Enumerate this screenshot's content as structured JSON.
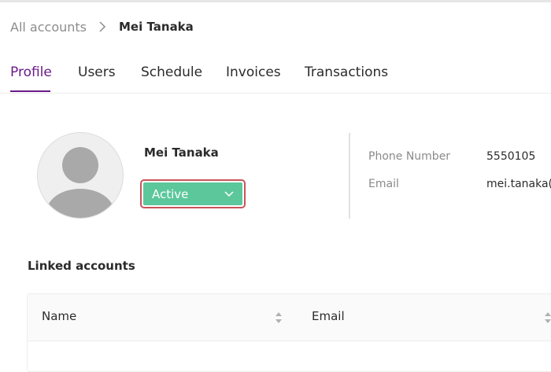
{
  "breadcrumb": {
    "root": "All accounts",
    "current": "Mei Tanaka"
  },
  "tabs": [
    {
      "label": "Profile",
      "active": true
    },
    {
      "label": "Users",
      "active": false
    },
    {
      "label": "Schedule",
      "active": false
    },
    {
      "label": "Invoices",
      "active": false
    },
    {
      "label": "Transactions",
      "active": false
    }
  ],
  "profile": {
    "name": "Mei Tanaka",
    "status": "Active"
  },
  "contact": {
    "phone_label": "Phone Number",
    "phone_value": "5550105",
    "email_label": "Email",
    "email_value": "mei.tanaka("
  },
  "linked_accounts": {
    "title": "Linked accounts",
    "columns": [
      "Name",
      "Email"
    ]
  },
  "colors": {
    "accent": "#6a1b8a",
    "status_active": "#5dc79c",
    "focus_outline": "#c9545a"
  },
  "icons": {
    "breadcrumb_separator": "chevron-right-icon",
    "status_dropdown": "chevron-down-icon",
    "sort": "sort-icon",
    "avatar": "user-avatar-icon"
  }
}
